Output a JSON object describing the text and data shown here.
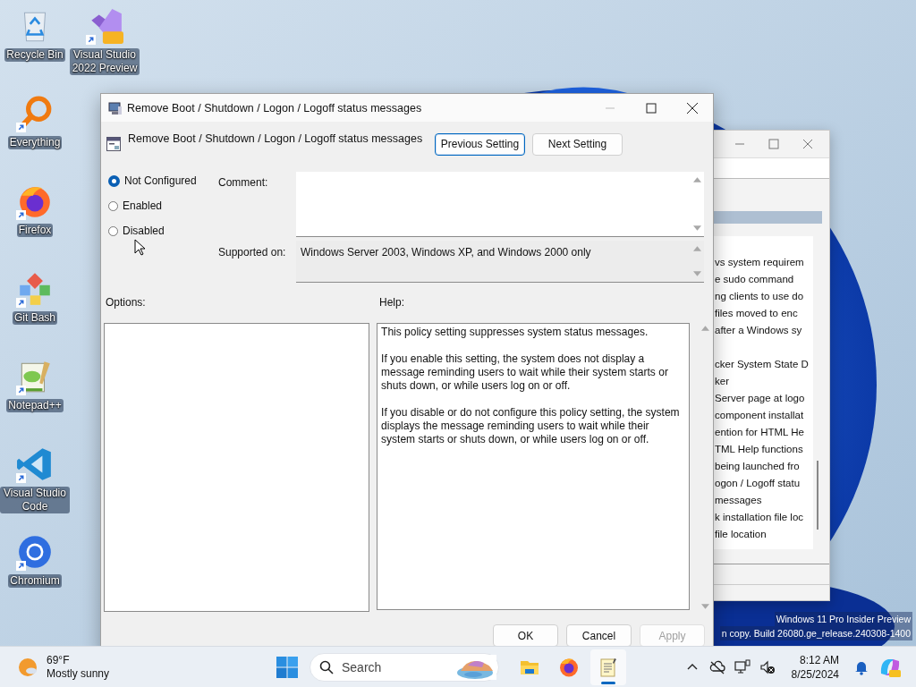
{
  "desktop_icons": [
    {
      "kind": "recycle",
      "label": "Recycle Bin",
      "shortcut": false
    },
    {
      "kind": "vspreview",
      "label": "Visual Studio 2022 Preview",
      "shortcut": true
    },
    {
      "kind": "everything",
      "label": "Everything",
      "shortcut": true
    },
    {
      "kind": "firefox",
      "label": "Firefox",
      "shortcut": true
    },
    {
      "kind": "gitbash",
      "label": "Git Bash",
      "shortcut": true
    },
    {
      "kind": "notepad",
      "label": "Notepad++",
      "shortcut": true
    },
    {
      "kind": "vscode",
      "label": "Visual Studio Code",
      "shortcut": true
    },
    {
      "kind": "chromium",
      "label": "Chromium",
      "shortcut": true
    }
  ],
  "background_window": {
    "list_items": [
      "vs system requirem",
      "e sudo command",
      "ng clients to use do",
      "files moved to enc",
      "after a Windows sy",
      "cker System State D",
      "ker",
      "Server page at logo",
      "component installat",
      "ention for HTML He",
      "TML Help functions",
      "being launched fro",
      "ogon / Logoff statu",
      "messages",
      "k installation file loc",
      "file location"
    ]
  },
  "dialog": {
    "title": "Remove Boot / Shutdown / Logon / Logoff status messages",
    "setting_title": "Remove Boot / Shutdown / Logon / Logoff status messages",
    "nav_buttons": [
      {
        "label": "Previous Setting",
        "focused": true
      },
      {
        "label": "Next Setting",
        "focused": false
      }
    ],
    "states": [
      {
        "label": "Not Configured",
        "selected": true
      },
      {
        "label": "Enabled",
        "selected": false
      },
      {
        "label": "Disabled",
        "selected": false
      }
    ],
    "comment_label": "Comment:",
    "supported_label": "Supported on:",
    "supported_value": "Windows Server 2003, Windows XP, and Windows 2000 only",
    "options_label": "Options:",
    "help_label": "Help:",
    "help_paragraphs": [
      "This policy setting suppresses system status messages.",
      "If you enable this setting, the system does not display a message reminding users to wait while their system starts or shuts down, or while users log on or off.",
      "If you disable or do not configure this policy setting, the system displays the message reminding users to wait while their system starts or shuts down, or while users log on or off."
    ],
    "buttons": [
      {
        "label": "OK",
        "disabled": false
      },
      {
        "label": "Cancel",
        "disabled": false
      },
      {
        "label": "Apply",
        "disabled": true
      }
    ]
  },
  "watermark_lines": [
    "Windows 11 Pro Insider Preview",
    "n copy. Build 26080.ge_release.240308-1400"
  ],
  "taskbar": {
    "weather": {
      "temperature": "69°F",
      "condition": "Mostly sunny"
    },
    "search": {
      "placeholder": "Search"
    },
    "apps": [
      {
        "kind": "explorer",
        "active": false
      },
      {
        "kind": "firefox",
        "active": false
      },
      {
        "kind": "notepad",
        "active": true
      }
    ],
    "time": "8:12 AM",
    "date": "8/25/2024"
  }
}
